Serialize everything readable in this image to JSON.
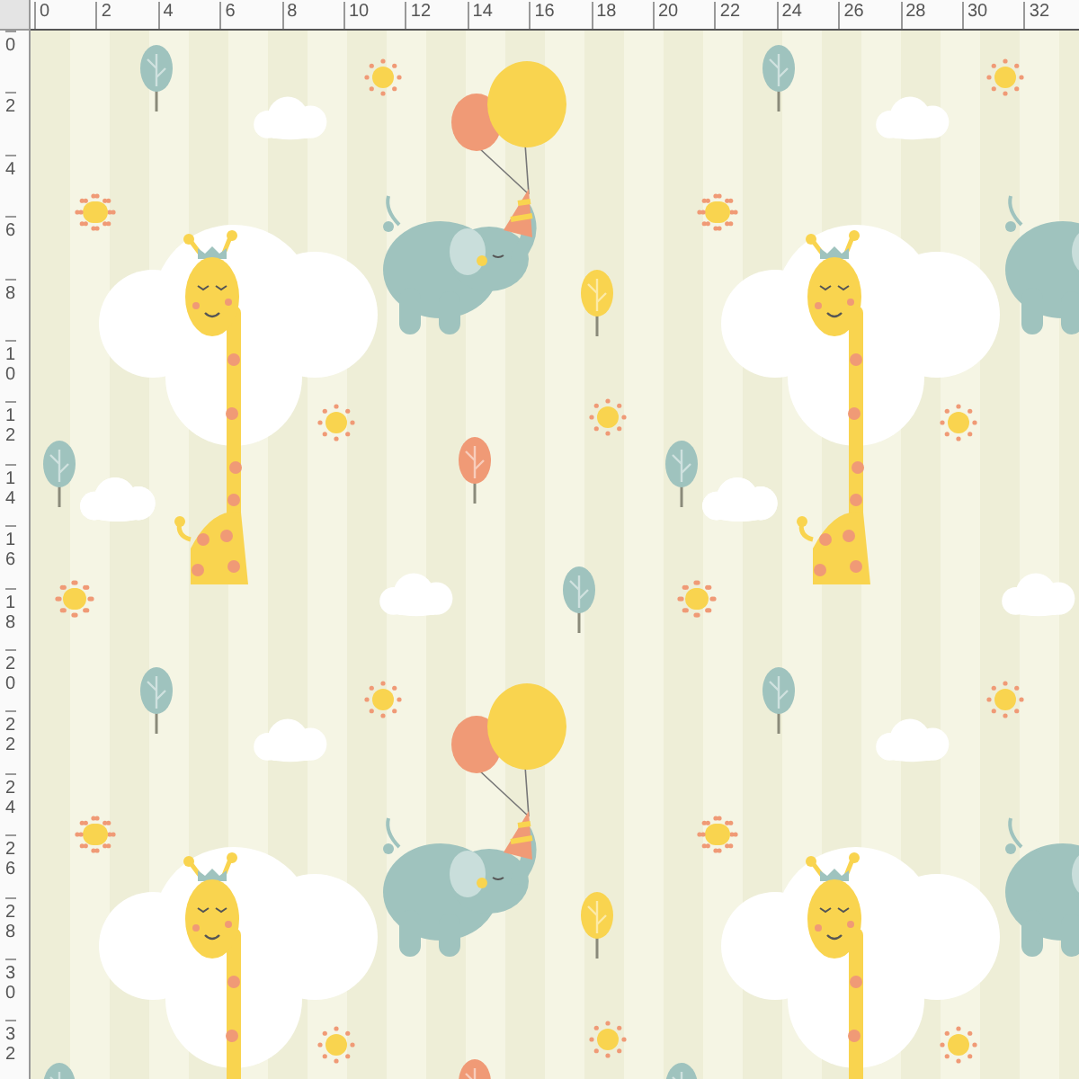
{
  "ruler_top": {
    "labels": [
      "0",
      "2",
      "4",
      "6",
      "8",
      "10",
      "12",
      "14",
      "16",
      "18",
      "20",
      "22",
      "24",
      "26",
      "28",
      "30",
      "32"
    ]
  },
  "ruler_left": {
    "labels": [
      "0",
      "2",
      "4",
      "6",
      "8",
      "10",
      "12",
      "14",
      "16",
      "18",
      "20",
      "22",
      "24",
      "26",
      "28",
      "30",
      "32"
    ]
  }
}
